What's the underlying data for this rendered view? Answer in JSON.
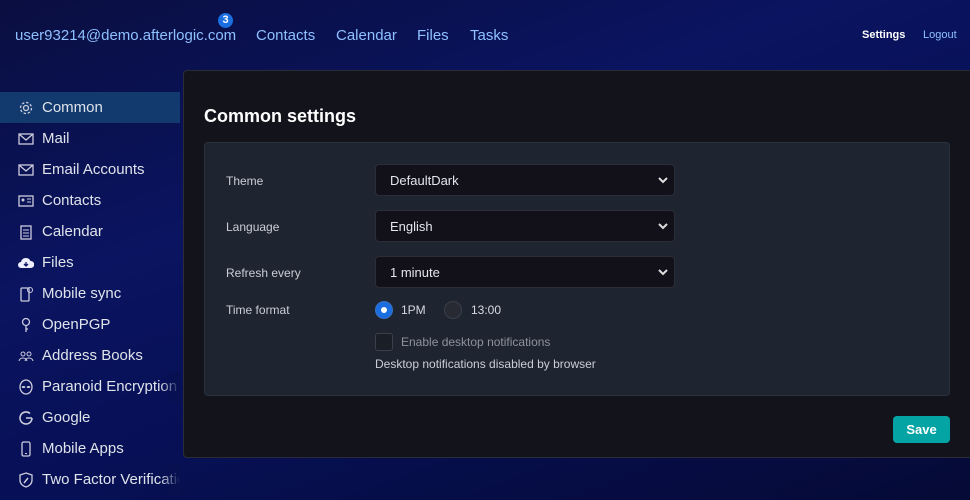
{
  "header": {
    "user_email": "user93214@demo.afterlogic.com",
    "unread_count": "3",
    "nav": [
      "Contacts",
      "Calendar",
      "Files",
      "Tasks"
    ],
    "settings": "Settings",
    "logout": "Logout"
  },
  "sidebar": {
    "items": [
      {
        "label": "Common",
        "icon": "gear-icon",
        "active": true
      },
      {
        "label": "Mail",
        "icon": "envelope-icon"
      },
      {
        "label": "Email Accounts",
        "icon": "envelope-icon"
      },
      {
        "label": "Contacts",
        "icon": "contact-card-icon"
      },
      {
        "label": "Calendar",
        "icon": "calendar-icon"
      },
      {
        "label": "Files",
        "icon": "cloud-download-icon"
      },
      {
        "label": "Mobile sync",
        "icon": "mobile-sync-icon"
      },
      {
        "label": "OpenPGP",
        "icon": "key-icon"
      },
      {
        "label": "Address Books",
        "icon": "people-icon"
      },
      {
        "label": "Paranoid Encryption",
        "icon": "alien-icon"
      },
      {
        "label": "Google",
        "icon": "google-icon"
      },
      {
        "label": "Mobile Apps",
        "icon": "phone-icon"
      },
      {
        "label": "Two Factor Verification",
        "icon": "shield-icon"
      }
    ]
  },
  "main": {
    "title": "Common settings",
    "theme": {
      "label": "Theme",
      "value": "DefaultDark"
    },
    "language": {
      "label": "Language",
      "value": "English"
    },
    "refresh": {
      "label": "Refresh every",
      "value": "1 minute"
    },
    "time_format": {
      "label": "Time format",
      "options": [
        "1PM",
        "13:00"
      ],
      "selected": "1PM"
    },
    "notifications": {
      "label": "Enable desktop notifications",
      "checked": false,
      "note": "Desktop notifications disabled by browser"
    },
    "save": "Save"
  },
  "colors": {
    "accent": "#04a4a4",
    "active_item": "#123a6e",
    "badge": "#1a6ee0",
    "radio": "#1a6ee0"
  }
}
